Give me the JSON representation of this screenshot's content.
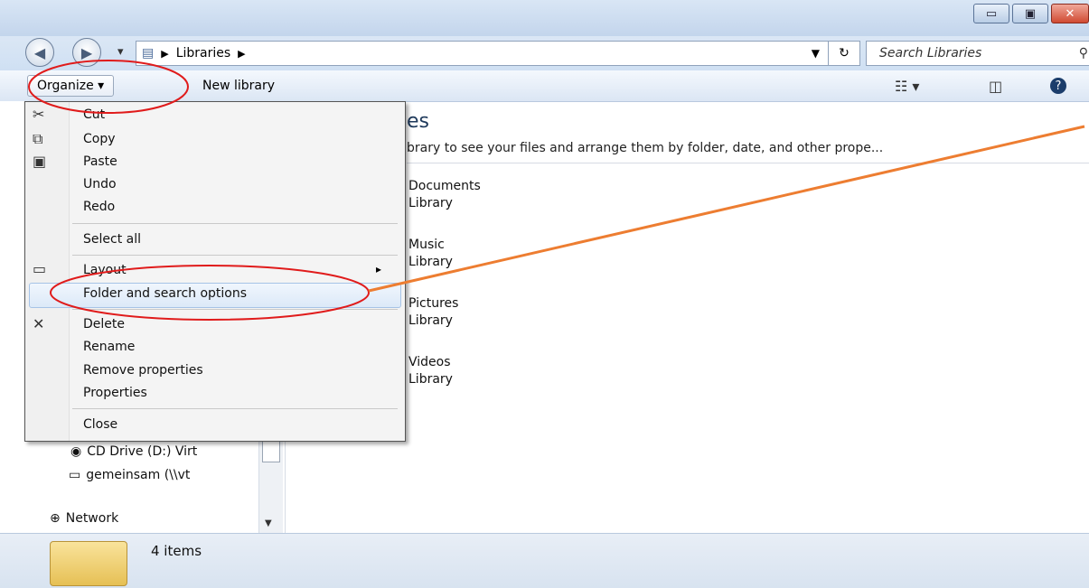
{
  "window": {
    "controls": {
      "minimize": "▭",
      "maximize": "▣",
      "close": "✕"
    }
  },
  "address_bar": {
    "back_glyph": "◀",
    "forward_glyph": "▶",
    "dropdown_glyph": "▾",
    "breadcrumb": [
      "Libraries"
    ],
    "refresh_glyph": "↻",
    "search_placeholder": "Search Libraries",
    "search_icon": "search-icon"
  },
  "toolbar": {
    "organize_label": "Organize ▾",
    "new_library_label": "New library",
    "views_glyph": "☷ ▾",
    "preview_glyph": "◫",
    "help_glyph": "?"
  },
  "organize_menu": {
    "items": {
      "cut": "Cut",
      "copy": "Copy",
      "paste": "Paste",
      "undo": "Undo",
      "redo": "Redo",
      "select_all": "Select all",
      "layout": "Layout",
      "folder_options": "Folder and search options",
      "delete": "Delete",
      "rename": "Rename",
      "remove_properties": "Remove properties",
      "properties": "Properties",
      "close": "Close"
    },
    "submenu_arrow": "▸"
  },
  "nav_pane": {
    "items": [
      {
        "label": "CD Drive (D:) Virt",
        "icon": "cd-drive-icon"
      },
      {
        "label": "gemeinsam (\\\\vt",
        "icon": "network-drive-icon"
      },
      {
        "label": "Network",
        "icon": "network-icon"
      }
    ]
  },
  "content": {
    "title_partial": "es",
    "description_partial": "brary to see your files and arrange them by folder, date, and other prope...",
    "libraries": [
      {
        "name": "Documents",
        "type": "Library"
      },
      {
        "name": "Music",
        "type": "Library"
      },
      {
        "name": "Pictures",
        "type": "Library"
      },
      {
        "name": "Videos",
        "type": "Library"
      }
    ]
  },
  "status_bar": {
    "item_count": "4 items"
  },
  "annotation_colors": {
    "circle": "#e01b1b",
    "arrow_line": "#ed7d31"
  }
}
